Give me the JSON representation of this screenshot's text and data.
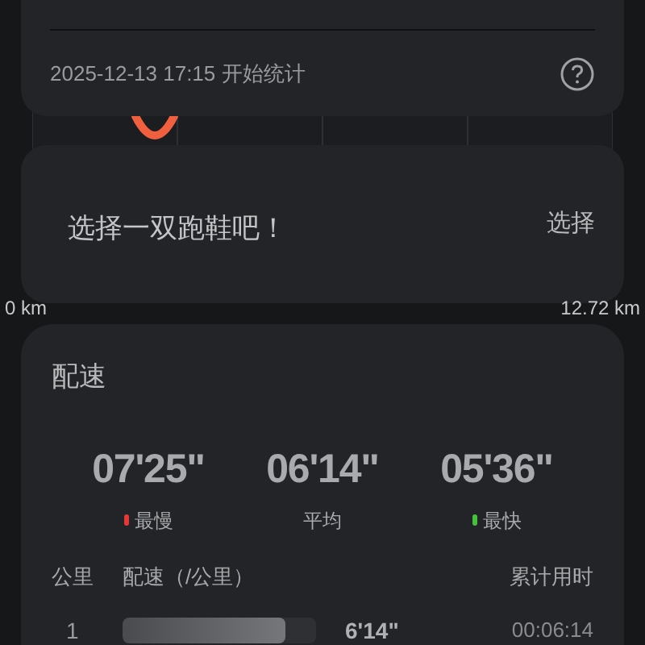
{
  "summary_card": {
    "start_time": "2025-12-13 17:15",
    "start_label": "开始统计"
  },
  "chart_background": {
    "x_labels": [
      "0 km",
      "12.72 km"
    ]
  },
  "shoe_card": {
    "prompt": "选择一双跑鞋吧！",
    "action": "选择"
  },
  "pace": {
    "title": "配速",
    "stats": [
      {
        "value": "07'25\"",
        "label": "最慢",
        "color": "#e53935"
      },
      {
        "value": "06'14\"",
        "label": "平均"
      },
      {
        "value": "05'36\"",
        "label": "最快",
        "color": "#43c23a"
      }
    ],
    "columns": [
      "公里",
      "配速（/公里）",
      "累计用时"
    ],
    "rows": [
      {
        "km": "1",
        "pace": "6'14\"",
        "level": 0.84,
        "total": "00:06:14"
      }
    ]
  }
}
